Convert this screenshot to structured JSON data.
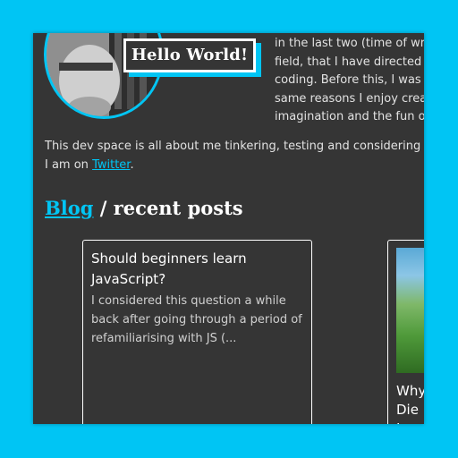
{
  "header": {
    "greeting": "Hello World!"
  },
  "intro": {
    "lines": [
      "in the last two (time of wr",
      "field, that I have directed",
      "coding. Before this, I was",
      "same reasons I enjoy crea",
      "imagination and the fun of"
    ]
  },
  "devspace": {
    "line1": "This dev space is all about me tinkering, testing and considering c",
    "line2_prefix": "I am on ",
    "twitter_link": "Twitter",
    "line2_suffix": "."
  },
  "blog": {
    "link_label": "Blog",
    "heading_suffix": " / recent posts"
  },
  "posts": [
    {
      "title": "Should beginners learn JavaScript?",
      "excerpt": "I considered this question a while back after going through a period of refamiliarising with JS (..."
    },
    {
      "title_line1": "Why",
      "title_line2": "Die",
      "title_line3": "I"
    }
  ],
  "colors": {
    "accent": "#00c5f4",
    "panel": "#353535"
  }
}
